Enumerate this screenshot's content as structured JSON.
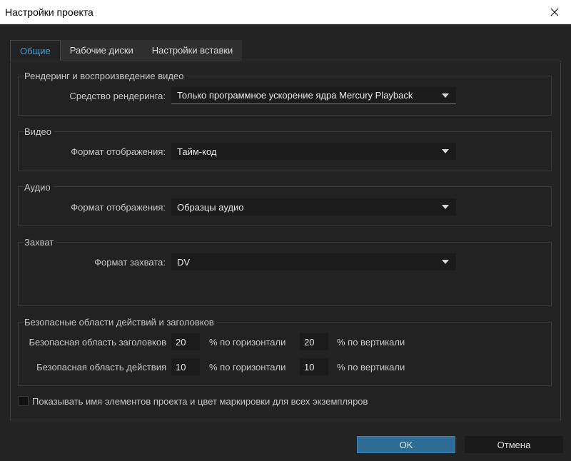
{
  "window": {
    "title": "Настройки проекта"
  },
  "tabs": [
    {
      "label": "Общие",
      "active": true
    },
    {
      "label": "Рабочие диски",
      "active": false
    },
    {
      "label": "Настройки вставки",
      "active": false
    }
  ],
  "rendering": {
    "group_label": "Рендеринг и воспроизведение видео",
    "renderer_label": "Средство рендеринга:",
    "renderer_value": "Только программное ускорение ядра Mercury Playback"
  },
  "video": {
    "group_label": "Видео",
    "display_format_label": "Формат отображения:",
    "display_format_value": "Тайм-код"
  },
  "audio": {
    "group_label": "Аудио",
    "display_format_label": "Формат отображения:",
    "display_format_value": "Образцы аудио"
  },
  "capture": {
    "group_label": "Захват",
    "capture_format_label": "Формат захвата:",
    "capture_format_value": "DV"
  },
  "safe_margins": {
    "group_label": "Безопасные области действий и заголовков",
    "title_safe": {
      "label": "Безопасная область заголовков",
      "horizontal": "20",
      "horizontal_unit": "% по горизонтали",
      "vertical": "20",
      "vertical_unit": "% по вертикали"
    },
    "action_safe": {
      "label": "Безопасная область действия",
      "horizontal": "10",
      "horizontal_unit": "% по горизонтали",
      "vertical": "10",
      "vertical_unit": "% по вертикали"
    }
  },
  "show_names_checkbox": {
    "label": "Показывать имя элементов проекта и цвет маркировки для всех экземпляров",
    "checked": false
  },
  "buttons": {
    "ok": "OK",
    "cancel": "Отмена"
  },
  "colors": {
    "accent": "#3ea1df",
    "ok_button": "#2c6c95",
    "background": "#232323"
  }
}
